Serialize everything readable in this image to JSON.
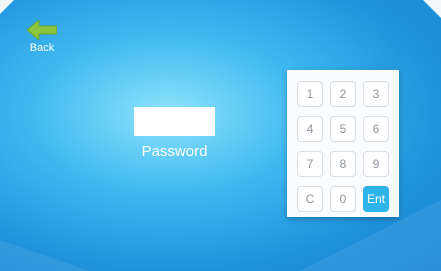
{
  "back": {
    "label": "Back",
    "icon": "arrow-left-icon"
  },
  "password": {
    "label": "Password",
    "value": "",
    "placeholder": ""
  },
  "keypad": {
    "keys": [
      "1",
      "2",
      "3",
      "4",
      "5",
      "6",
      "7",
      "8",
      "9",
      "C",
      "0",
      "Ent"
    ],
    "accent_color": "#2fb4ea"
  },
  "colors": {
    "background": "#3fbaf0",
    "back_arrow": "#8cc63f"
  }
}
